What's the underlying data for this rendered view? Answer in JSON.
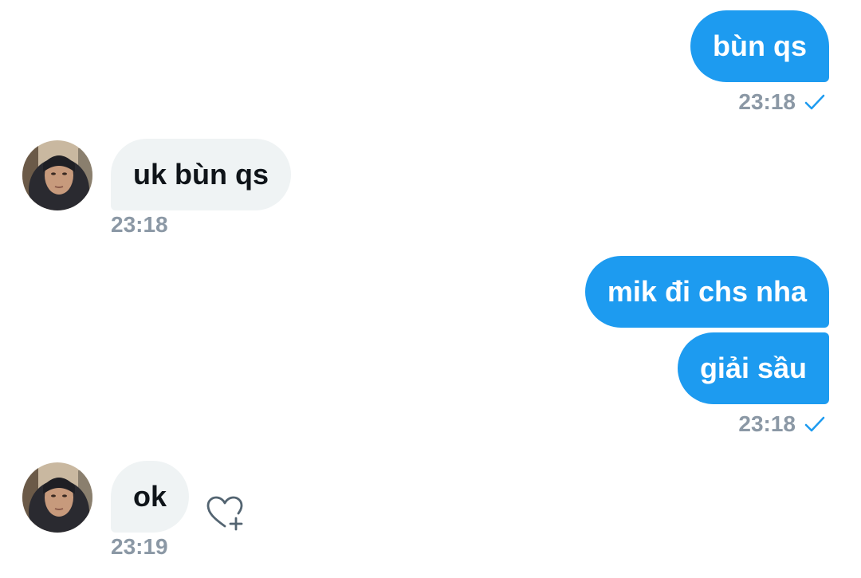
{
  "messages": [
    {
      "direction": "out",
      "text": "bùn qs",
      "time": "23:18",
      "seen": true
    },
    {
      "direction": "in",
      "text": "uk bùn qs",
      "time": "23:18"
    },
    {
      "direction": "out",
      "text": "mik đi chs nha"
    },
    {
      "direction": "out",
      "text": "giải sầu",
      "time": "23:18",
      "seen": true
    },
    {
      "direction": "in",
      "text": "ok",
      "time": "23:19"
    }
  ],
  "icons": {
    "sent_status": "check-icon",
    "react": "heart-plus-icon",
    "avatar": "avatar"
  },
  "colors": {
    "outgoing_bubble": "#1d9bf0",
    "incoming_bubble": "#eff3f4",
    "timestamp": "#8b98a5",
    "check": "#1d9bf0"
  }
}
